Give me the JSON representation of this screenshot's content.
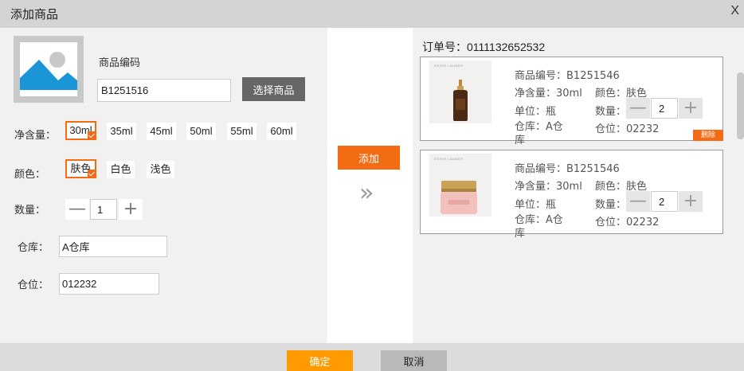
{
  "dialog": {
    "title": "添加商品",
    "close_label": "X"
  },
  "form": {
    "code_label": "商品编码",
    "code_value": "B1251516",
    "select_button": "选择商品",
    "volume_label": "净含量：",
    "volume_options": [
      "30ml",
      "35ml",
      "45ml",
      "50ml",
      "55ml",
      "60ml"
    ],
    "volume_selected": "30ml",
    "color_label": "颜色：",
    "color_options": [
      "肤色",
      "白色",
      "浅色"
    ],
    "color_selected": "肤色",
    "quantity_label": "数量：",
    "quantity_value": "1",
    "warehouse_label": "仓库：",
    "warehouse_value": "A仓库",
    "location_label": "仓位：",
    "location_value": "012232"
  },
  "middle": {
    "add_button": "添加",
    "arrow_glyph": "»"
  },
  "order": {
    "label": "订单号：",
    "number": "0111132652532",
    "items": [
      {
        "product_no": "商品编号：B1251546",
        "volume": "净含量：30ml",
        "color": "颜色：肤色",
        "unit": "单位：瓶",
        "quantity_label": "数量：",
        "quantity": "2",
        "warehouse": "仓库：A仓库",
        "location": "仓位：02232",
        "brand_text": "ESTEE LAUDER",
        "delete_label": "删除"
      },
      {
        "product_no": "商品编号：B1251546",
        "volume": "净含量：30ml",
        "color": "颜色：肤色",
        "unit": "单位：瓶",
        "quantity_label": "数量：",
        "quantity": "2",
        "warehouse": "仓库：A仓库",
        "location": "仓位：02232",
        "brand_text": "ESTEE LAUDER"
      }
    ]
  },
  "footer": {
    "ok_button": "确定",
    "cancel_button": "取消"
  },
  "colors": {
    "accent": "#f36b12",
    "confirm": "#ff9b00"
  }
}
